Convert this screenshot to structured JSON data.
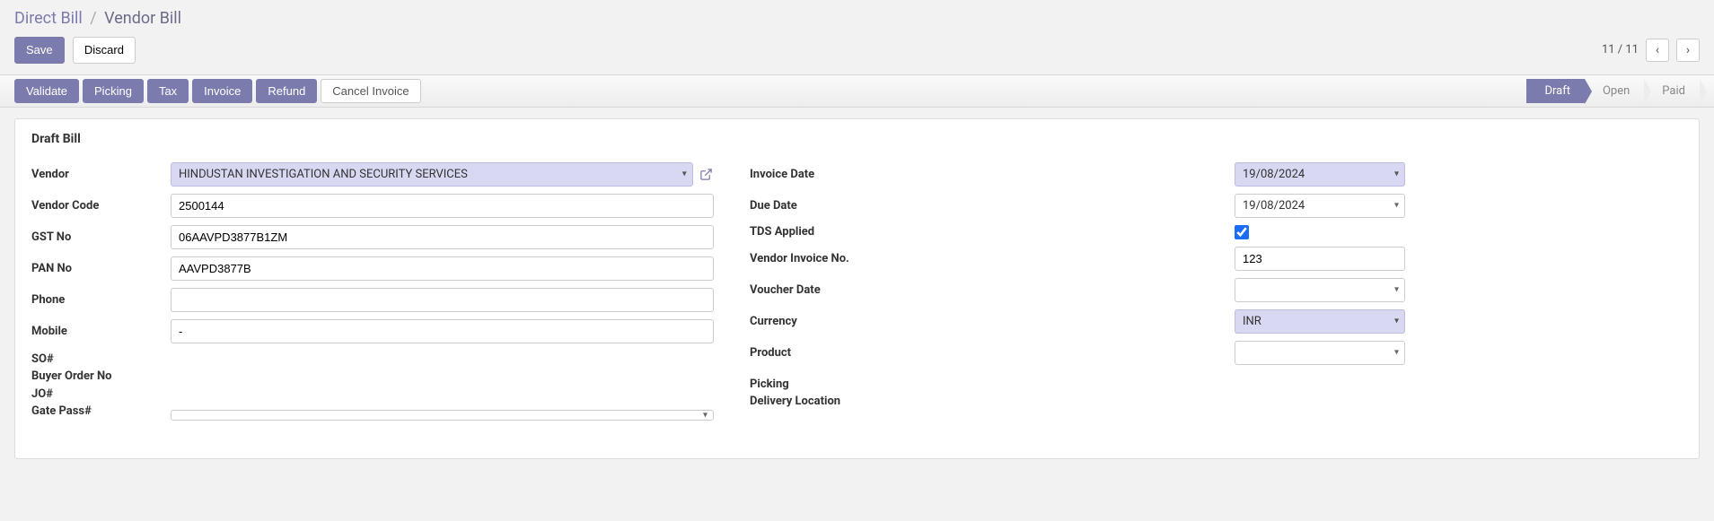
{
  "breadcrumbs": {
    "parent": "Direct Bill",
    "current": "Vendor Bill"
  },
  "buttons": {
    "save": "Save",
    "discard": "Discard"
  },
  "pager": {
    "text": "11 / 11"
  },
  "actions": {
    "validate": "Validate",
    "picking": "Picking",
    "tax": "Tax",
    "invoice": "Invoice",
    "refund": "Refund",
    "cancel_invoice": "Cancel Invoice"
  },
  "status": {
    "draft": "Draft",
    "open": "Open",
    "paid": "Paid"
  },
  "sheet_title": "Draft Bill",
  "labels": {
    "vendor": "Vendor",
    "vendor_code": "Vendor Code",
    "gst_no": "GST No",
    "pan_no": "PAN No",
    "phone": "Phone",
    "mobile": "Mobile",
    "so": "SO#",
    "buyer_order_no": "Buyer Order No",
    "jo": "JO#",
    "gate_pass": "Gate Pass#",
    "invoice_date": "Invoice Date",
    "due_date": "Due Date",
    "tds_applied": "TDS Applied",
    "vendor_invoice_no": "Vendor Invoice No.",
    "voucher_date": "Voucher Date",
    "currency": "Currency",
    "product": "Product",
    "picking_label": "Picking",
    "delivery_location": "Delivery Location"
  },
  "values": {
    "vendor": "HINDUSTAN INVESTIGATION AND SECURITY  SERVICES",
    "vendor_code": "2500144",
    "gst_no": "06AAVPD3877B1ZM",
    "pan_no": "AAVPD3877B",
    "phone": "",
    "mobile": "-",
    "gate_pass": "",
    "invoice_date": "19/08/2024",
    "due_date": "19/08/2024",
    "tds_applied": true,
    "vendor_invoice_no": "123",
    "voucher_date": "",
    "currency": "INR",
    "product": ""
  }
}
